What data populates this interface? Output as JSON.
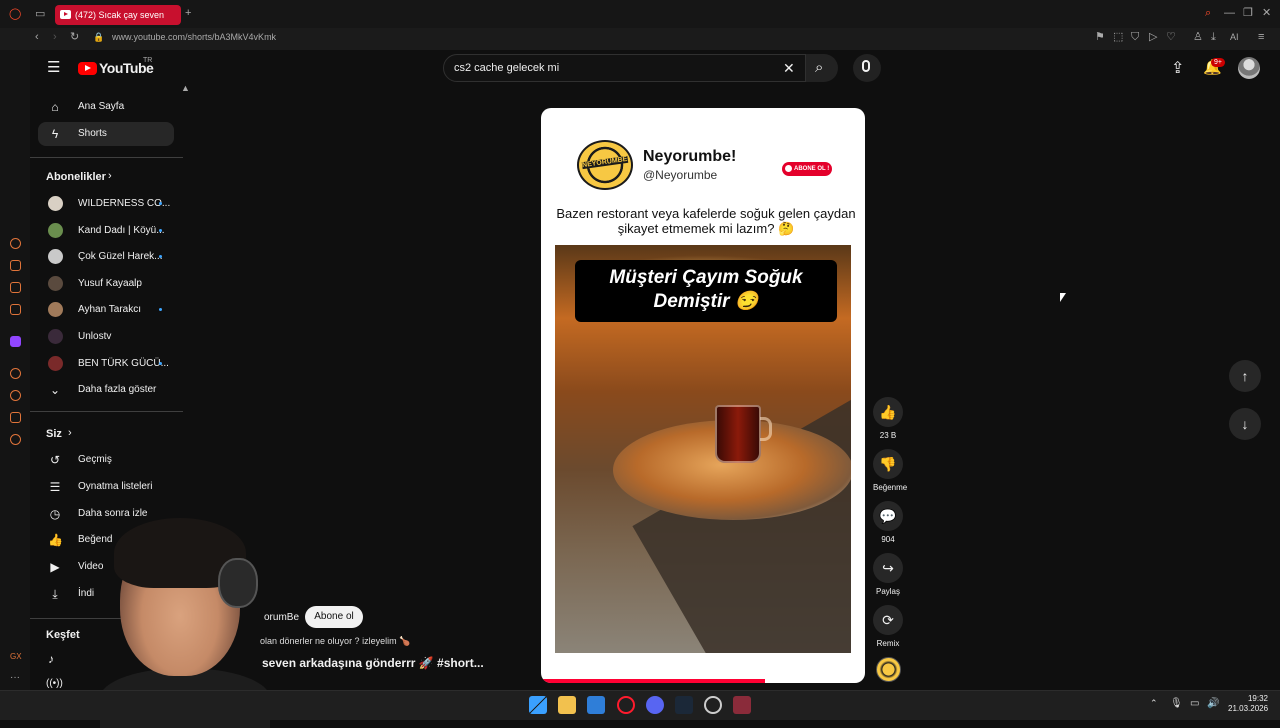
{
  "browser": {
    "tab_title": "(472) Sıcak çay seven",
    "url": "www.youtube.com/shorts/bA3MkV4vKmk",
    "ai_label": "AI"
  },
  "header": {
    "logo_text": "YouTube",
    "logo_region": "TR",
    "search_value": "cs2 cache gelecek mi",
    "notification_badge": "9+"
  },
  "sidebar": {
    "main": [
      {
        "label": "Ana Sayfa",
        "icon": "home-icon"
      },
      {
        "label": "Shorts",
        "icon": "shorts-icon",
        "active": true
      }
    ],
    "subscriptions_title": "Abonelikler",
    "subscriptions": [
      {
        "label": "WILDERNESS CO...",
        "color": "#d9d0c4",
        "dot": true
      },
      {
        "label": "Kand Dadı | Köyü...",
        "color": "#6a8e4e",
        "dot": true
      },
      {
        "label": "Çok Güzel Harek...",
        "color": "#c9c9c9",
        "dot": true
      },
      {
        "label": "Yusuf Kayaalp",
        "color": "#5a4a3e",
        "dot": false
      },
      {
        "label": "Ayhan Tarakcı",
        "color": "#a07a5a",
        "dot": true
      },
      {
        "label": "Unlostv",
        "color": "#3a2a3a",
        "dot": false
      },
      {
        "label": "BEN TÜRK GÜCÜ...",
        "color": "#7a2a2a",
        "dot": true
      }
    ],
    "show_more": "Daha fazla göster",
    "you_title": "Siz",
    "you_items": [
      {
        "label": "Geçmiş",
        "icon": "history-icon"
      },
      {
        "label": "Oynatma listeleri",
        "icon": "playlist-icon"
      },
      {
        "label": "Daha sonra izle",
        "icon": "clock-icon"
      },
      {
        "label": "Beğend",
        "icon": "thumb-up-icon"
      },
      {
        "label": "Video",
        "icon": "video-icon"
      },
      {
        "label": "İndi",
        "icon": "download-icon"
      }
    ],
    "explore_title": "Keşfet"
  },
  "short": {
    "brand_logo_text": "NEYORUMBE!",
    "brand_name": "Neyorumbe!",
    "brand_handle": "@Neyorumbe",
    "abone_badge": "ABONE OL !",
    "caption": "Bazen restorant veya kafelerde soğuk gelen çaydan şikayet etmemek mi lazım? 🤔",
    "overlay_title": "Müşteri Çayım Soğuk Demiştir 😏",
    "progress": 0.69,
    "channel": "orumBe",
    "subscribe_label": "Abone ol",
    "subtitle": "olan dönerler ne oluyor ? izleyelim 🍗",
    "title": "seven arkadaşına gönderrr 🚀 #short..."
  },
  "actions": [
    {
      "name": "like",
      "icon": "👍",
      "label": "23 B"
    },
    {
      "name": "dislike",
      "icon": "👎",
      "label": "Beğenme"
    },
    {
      "name": "comments",
      "icon": "💬",
      "label": "904"
    },
    {
      "name": "share",
      "icon": "↪",
      "label": "Paylaş"
    },
    {
      "name": "remix",
      "icon": "⟳",
      "label": "Remix"
    }
  ],
  "clock": {
    "time": "19:32",
    "date": "21.03.2026"
  }
}
